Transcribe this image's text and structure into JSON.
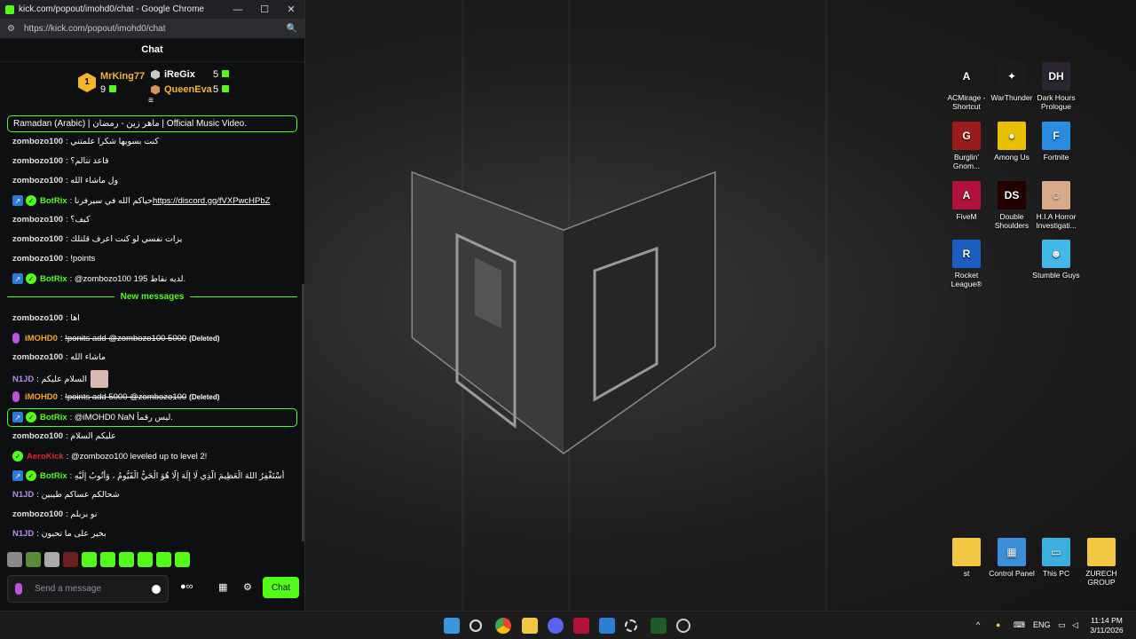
{
  "window": {
    "title": "kick.com/popout/imohd0/chat - Google Chrome",
    "url": "https://kick.com/popout/imohd0/chat",
    "controls": {
      "minimize": "—",
      "maximize": "☐",
      "close": "✕"
    }
  },
  "chat": {
    "header": "Chat",
    "leaderboard": {
      "rank": "1",
      "first": {
        "name": "MrKing77",
        "points": "9"
      },
      "second": {
        "name": "iReGix",
        "points": "5"
      },
      "third": {
        "name": "QueenEva",
        "points": "5"
      }
    },
    "pinned": "Ramadan (Arabic) | ماهر زين - رمضان | Official Music Video.",
    "messages": [
      {
        "user": "zombozo100",
        "text": "كنت بسويها شكرا علمتني"
      },
      {
        "user": "zombozo100",
        "text": "قاعد تتألم؟"
      },
      {
        "user": "zombozo100",
        "text": "ول ماشاء الله"
      },
      {
        "user": "BotRix",
        "text": "حياكم الله في سيرفرنا ",
        "link": "https://discord.gg/fVXPwcHPbZ"
      },
      {
        "user": "zombozo100",
        "text": "كيف؟"
      },
      {
        "user": "zombozo100",
        "text": "يزات نفسي لو كنت اعرف قلتلك"
      },
      {
        "user": "zombozo100",
        "text": "!points"
      },
      {
        "user": "BotRix",
        "text": "@zombozo100 لديه نقاط 195."
      },
      {
        "user": "zombozo100",
        "text": "اها"
      },
      {
        "user": "iMOHD0",
        "text": "!ponits add @zombozo100 5000",
        "deleted": "(Deleted)"
      },
      {
        "user": "zombozo100",
        "text": "ماشاء الله"
      },
      {
        "user": "N1JD",
        "text": "السلام عليكم"
      },
      {
        "user": "iMOHD0",
        "text": "!points add 5000 @zombozo100",
        "deleted": "(Deleted)"
      },
      {
        "user": "BotRix",
        "text": "@iMOHD0 NaN ليس رقماً."
      },
      {
        "user": "zombozo100",
        "text": "عليكم السلام"
      },
      {
        "user": "AeroKick",
        "text": "@zombozo100 leveled up to level 2!"
      },
      {
        "user": "BotRix",
        "text": "أَسْتَغْفِرُ اللهَ الْعَظِيمَ الَّذِي لَا إِلَهَ إِلَّا هُوَ الْحَيُّ الْقَيُّومُ ، وَأَتُوبُ إِلَيْهِ"
      },
      {
        "user": "N1JD",
        "text": "شحالكم عساكم طيبين"
      },
      {
        "user": "zombozo100",
        "text": "نو بربلم"
      },
      {
        "user": "N1JD",
        "text": "بخير على ما تحبون"
      }
    ],
    "separator": "New messages",
    "input_placeholder": "Send a message",
    "send_label": "Chat"
  },
  "desktop_icons": [
    {
      "label": "ACMirage - Shortcut",
      "color": "#1a1a1a",
      "glyph": "A"
    },
    {
      "label": "WarThunder",
      "color": "#1c1c1c",
      "glyph": "✦"
    },
    {
      "label": "Dark Hours Prologue",
      "color": "#2a2530",
      "glyph": "DH"
    },
    {
      "label": "Burglin' Gnom...",
      "color": "#9b1c1c",
      "glyph": "G"
    },
    {
      "label": "Among Us",
      "color": "#e8c000",
      "glyph": "●"
    },
    {
      "label": "Fortnite",
      "color": "#2b8de0",
      "glyph": "F"
    },
    {
      "label": "FiveM",
      "color": "#b0123b",
      "glyph": "A"
    },
    {
      "label": "Double Shoulders",
      "color": "#200",
      "glyph": "DS"
    },
    {
      "label": "H.I.A Horror Investigati...",
      "color": "#d8a98a",
      "glyph": "☺"
    },
    {
      "label": "Rocket League®",
      "color": "#1b5fc2",
      "glyph": "R"
    },
    {
      "label": "Stumble Guys",
      "color": "#42b8e8",
      "glyph": "☻"
    },
    {
      "label": "st",
      "color": "#f2c744",
      "glyph": ""
    },
    {
      "label": "Control Panel",
      "color": "#3a8fd8",
      "glyph": "▦"
    },
    {
      "label": "This PC",
      "color": "#3bb0e0",
      "glyph": "▭"
    },
    {
      "label": "ZURECH GROUP",
      "color": "#f2c744",
      "glyph": ""
    }
  ],
  "taskbar": {
    "tray_lang": "ENG",
    "time": "11:14 PM",
    "date": "3/11/2026",
    "tray_up": "^"
  }
}
